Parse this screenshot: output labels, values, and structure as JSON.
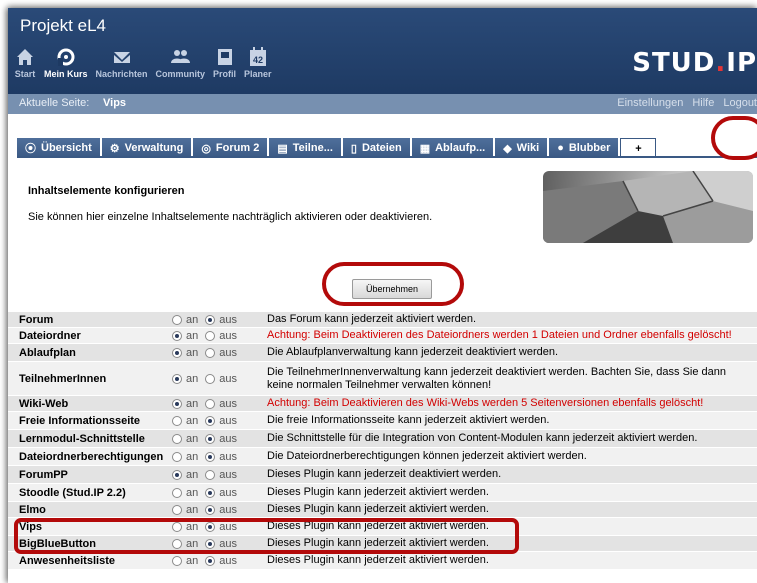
{
  "app": {
    "title": "Projekt eL4",
    "logo_main": "STUD",
    "logo_dot": ".",
    "logo_end": "IP"
  },
  "nav": [
    {
      "label": "Start",
      "icon": "home-icon"
    },
    {
      "label": "Mein Kurs",
      "icon": "course-icon"
    },
    {
      "label": "Nachrichten",
      "icon": "mail-icon"
    },
    {
      "label": "Community",
      "icon": "community-icon"
    },
    {
      "label": "Profil",
      "icon": "profile-icon"
    },
    {
      "label": "Planer",
      "icon": "calendar-icon",
      "icon_text": "42"
    }
  ],
  "breadcrumb": {
    "label": "Aktuelle Seite:",
    "value": "Vips",
    "links": [
      "Einstellungen",
      "Hilfe",
      "Logout"
    ]
  },
  "tabs": [
    {
      "label": "Übersicht",
      "icon": "overview-icon"
    },
    {
      "label": "Verwaltung",
      "icon": "admin-icon"
    },
    {
      "label": "Forum 2",
      "icon": "forum-icon"
    },
    {
      "label": "Teilne...",
      "icon": "participants-icon"
    },
    {
      "label": "Dateien",
      "icon": "files-icon"
    },
    {
      "label": "Ablaufp...",
      "icon": "schedule-icon"
    },
    {
      "label": "Wiki",
      "icon": "wiki-icon"
    },
    {
      "label": "Blubber",
      "icon": "blubber-icon"
    },
    {
      "label": "+",
      "icon": "plus-icon"
    }
  ],
  "content": {
    "title": "Inhaltselemente konfigurieren",
    "description": "Sie können hier einzelne Inhaltselemente nachträglich aktivieren oder deaktivieren.",
    "submit_label": "Übernehmen",
    "radio_on_label": "an",
    "radio_off_label": "aus"
  },
  "rows": [
    {
      "name": "Forum",
      "active": false,
      "desc": "Das Forum kann jederzeit aktiviert werden.",
      "warn": false
    },
    {
      "name": "Dateiordner",
      "active": true,
      "desc": "Achtung: Beim Deaktivieren des Dateiordners werden 1 Dateien und Ordner ebenfalls gelöscht!",
      "warn": true
    },
    {
      "name": "Ablaufplan",
      "active": true,
      "desc": "Die Ablaufplanverwaltung kann jederzeit deaktiviert werden.",
      "warn": false
    },
    {
      "name": "TeilnehmerInnen",
      "active": true,
      "desc": "Die TeilnehmerInnenverwaltung kann jederzeit deaktiviert werden. Bachten Sie, dass Sie dann keine normalen Teilnehmer verwalten können!",
      "warn": false
    },
    {
      "name": "Wiki-Web",
      "active": true,
      "desc": "Achtung: Beim Deaktivieren des Wiki-Webs werden 5 Seitenversionen ebenfalls gelöscht!",
      "warn": true
    },
    {
      "name": "Freie Informationsseite",
      "active": false,
      "desc": "Die freie Informationsseite kann jederzeit aktiviert werden.",
      "warn": false
    },
    {
      "name": "Lernmodul-Schnittstelle",
      "active": false,
      "desc": "Die Schnittstelle für die Integration von Content-Modulen kann jederzeit aktiviert werden.",
      "warn": false
    },
    {
      "name": "Dateiordnerberechtigungen",
      "active": false,
      "desc": "Die Dateiordnerberechtigungen können jederzeit aktiviert werden.",
      "warn": false
    },
    {
      "name": "ForumPP",
      "active": true,
      "desc": "Dieses Plugin kann jederzeit deaktiviert werden.",
      "warn": false
    },
    {
      "name": "Stoodle (Stud.IP 2.2)",
      "active": false,
      "desc": "Dieses Plugin kann jederzeit aktiviert werden.",
      "warn": false
    },
    {
      "name": "Elmo",
      "active": false,
      "desc": "Dieses Plugin kann jederzeit aktiviert werden.",
      "warn": false
    },
    {
      "name": "Vips",
      "active": false,
      "desc": "Dieses Plugin kann jederzeit aktiviert werden.",
      "warn": false
    },
    {
      "name": "BigBlueButton",
      "active": false,
      "desc": "Dieses Plugin kann jederzeit aktiviert werden.",
      "warn": false
    },
    {
      "name": "Anwesenheitsliste",
      "active": false,
      "desc": "Dieses Plugin kann jederzeit aktiviert werden.",
      "warn": false
    }
  ],
  "colors": {
    "header": "#1e3a63",
    "tab": "#3a5984",
    "annotation": "#b30a0a",
    "warning": "#d20000"
  }
}
